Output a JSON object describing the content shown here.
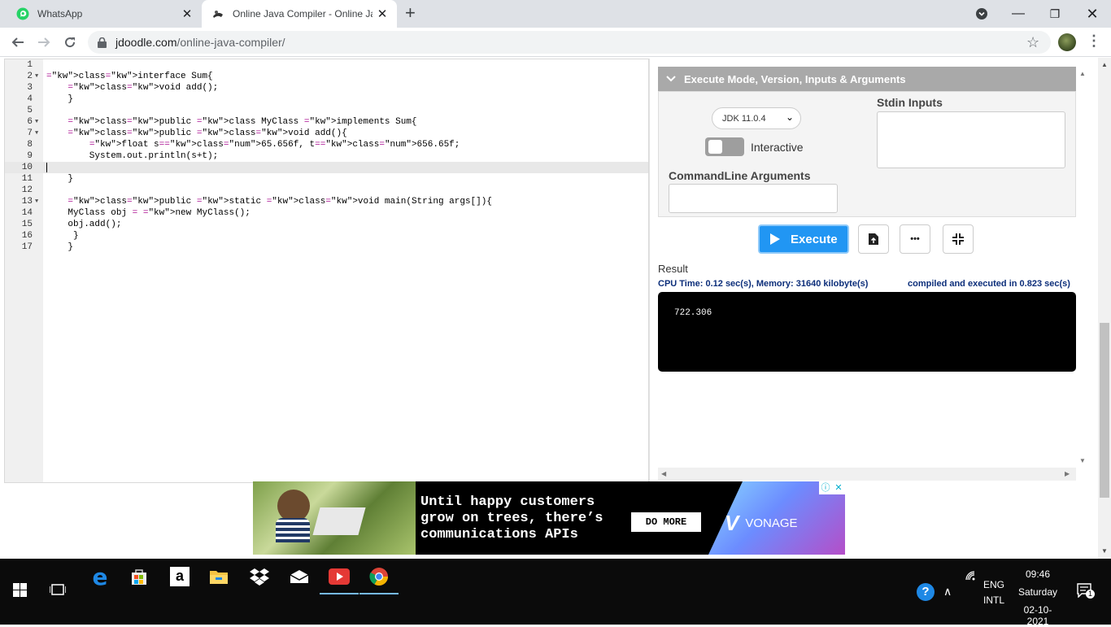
{
  "browser": {
    "tabs": [
      {
        "title": "WhatsApp"
      },
      {
        "title": "Online Java Compiler - Online Jav"
      }
    ],
    "new_tab": "+",
    "url_host": "jdoodle.com",
    "url_path": "/online-java-compiler/"
  },
  "editor": {
    "lines": [
      {
        "n": "1",
        "text": ""
      },
      {
        "n": "2",
        "text": "interface Sum{"
      },
      {
        "n": "3",
        "text": "    void add();"
      },
      {
        "n": "4",
        "text": "    }"
      },
      {
        "n": "5",
        "text": ""
      },
      {
        "n": "6",
        "text": "    public class MyClass implements Sum{"
      },
      {
        "n": "7",
        "text": "    public void add(){"
      },
      {
        "n": "8",
        "text": "        float s=65.656f, t=656.65f;"
      },
      {
        "n": "9",
        "text": "        System.out.println(s+t);"
      },
      {
        "n": "10",
        "text": ""
      },
      {
        "n": "11",
        "text": "    }"
      },
      {
        "n": "12",
        "text": ""
      },
      {
        "n": "13",
        "text": "    public static void main(String args[]){"
      },
      {
        "n": "14",
        "text": "    MyClass obj = new MyClass();"
      },
      {
        "n": "15",
        "text": "    obj.add();"
      },
      {
        "n": "16",
        "text": "     }"
      },
      {
        "n": "17",
        "text": "    }"
      }
    ]
  },
  "panel": {
    "header": "Execute Mode, Version, Inputs & Arguments",
    "jdk_version": "JDK 11.0.4",
    "interactive_label": "Interactive",
    "stdin_label": "Stdin Inputs",
    "cmd_label": "CommandLine Arguments",
    "execute_label": "Execute",
    "more_label": "•••",
    "result_label": "Result",
    "cpu_text": "CPU Time: 0.12 sec(s), Memory: 31640 kilobyte(s)",
    "compiled_text": "compiled and executed in 0.823 sec(s)",
    "output": "722.306"
  },
  "ad": {
    "headline": "Until happy customers\ngrow on trees, there’s\ncommunications APIs",
    "button": "DO MORE",
    "brand": "VONAGE",
    "info": "ⓘ",
    "close": "✕"
  },
  "taskbar": {
    "lang1": "ENG",
    "lang2": "INTL",
    "time": "09:46",
    "day": "Saturday",
    "date": "02-10-2021",
    "notif_count": "1"
  },
  "colors": {
    "accent": "#2196f3",
    "keyword": "#aa0d91",
    "result_blue": "#0c2e7a"
  }
}
